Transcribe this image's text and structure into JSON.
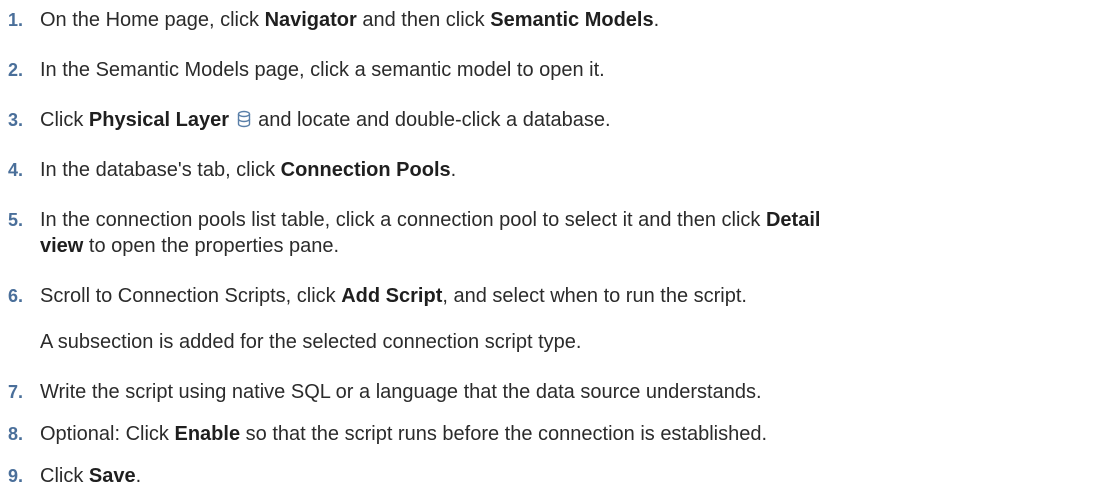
{
  "steps": [
    {
      "num": "1.",
      "parts": [
        "On the Home page, click ",
        "Navigator",
        " and then click ",
        "Semantic Models",
        "."
      ]
    },
    {
      "num": "2.",
      "text": "In the Semantic Models page, click a semantic model to open it."
    },
    {
      "num": "3.",
      "parts": [
        "Click ",
        "Physical Layer",
        " and locate and double-click a database."
      ],
      "icon": "database-icon"
    },
    {
      "num": "4.",
      "parts": [
        "In the database's tab, click ",
        "Connection Pools",
        "."
      ]
    },
    {
      "num": "5.",
      "line1_parts": [
        "In the connection pools list table, click a connection pool to select it and then click ",
        "Detail"
      ],
      "line2_parts": [
        "view",
        " to open the properties pane."
      ]
    },
    {
      "num": "6.",
      "parts": [
        "Scroll to Connection Scripts, click ",
        "Add Script",
        ", and select when to run the script."
      ],
      "note": "A subsection is added for the selected connection script type."
    },
    {
      "num": "7.",
      "text": "Write the script using native SQL or a language that the data source understands."
    },
    {
      "num": "8.",
      "parts": [
        "Optional: Click ",
        "Enable",
        " so that the script runs before the connection is established."
      ]
    },
    {
      "num": "9.",
      "parts": [
        "Click ",
        "Save",
        "."
      ]
    }
  ],
  "colors": {
    "step_number": "#4a6f9a",
    "text": "#2b2b2b",
    "icon": "#5a7fa8"
  }
}
